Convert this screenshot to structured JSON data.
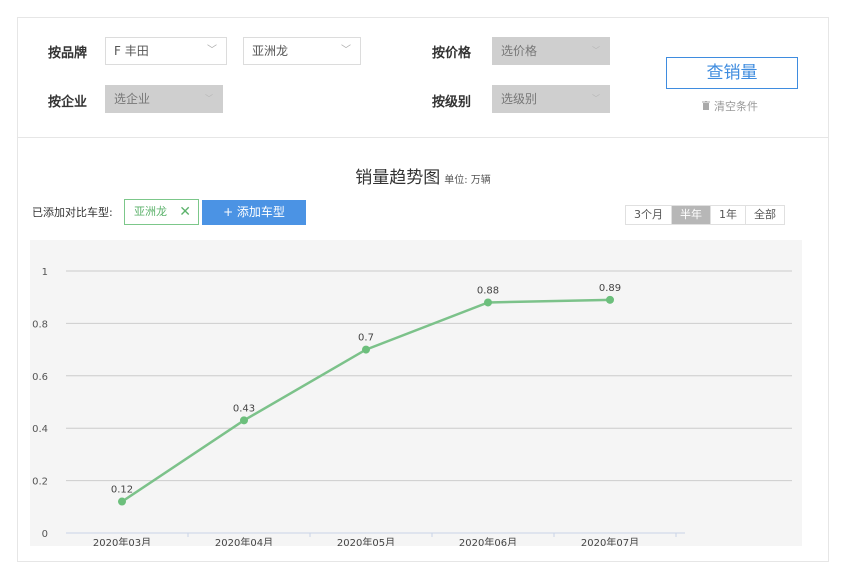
{
  "filters": {
    "brand_label": "按品牌",
    "brand_value": "F 丰田",
    "model_value": "亚洲龙",
    "price_label": "按价格",
    "price_placeholder": "选价格",
    "company_label": "按企业",
    "company_placeholder": "选企业",
    "level_label": "按级别",
    "level_placeholder": "选级别",
    "query_button": "查销量",
    "clear_label": "清空条件"
  },
  "chart_header": {
    "title": "销量趋势图",
    "unit": "单位: 万辆",
    "compare_label": "已添加对比车型:",
    "compare_tag": "亚洲龙",
    "add_button": "+ 添加车型",
    "ranges": [
      "3个月",
      "半年",
      "1年",
      "全部"
    ],
    "active_range": "半年"
  },
  "colors": {
    "line": "#7cc28a",
    "point": "#6cbf7c",
    "accent_blue": "#4b93e4",
    "grid": "#cccccc"
  },
  "chart_data": {
    "type": "line",
    "categories": [
      "2020年03月",
      "2020年04月",
      "2020年05月",
      "2020年06月",
      "2020年07月"
    ],
    "series": [
      {
        "values": [
          0.12,
          0.43,
          0.7,
          0.88,
          0.89
        ]
      }
    ],
    "ylim": [
      0,
      1
    ],
    "yticks": [
      "0",
      "0.2",
      "0.4",
      "0.6",
      "0.8",
      "1"
    ],
    "data_labels": [
      "0.12",
      "0.43",
      "0.7",
      "0.88",
      "0.89"
    ],
    "grid": true,
    "title": "销量趋势图",
    "xlabel": "",
    "ylabel": ""
  }
}
